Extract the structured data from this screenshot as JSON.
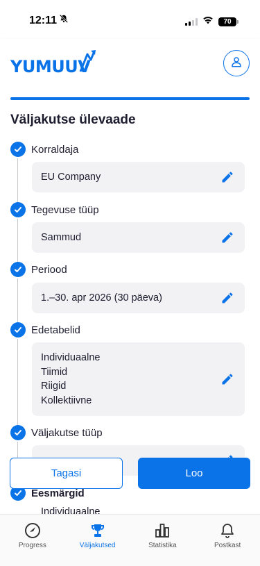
{
  "status_bar": {
    "time": "12:11",
    "battery": "70"
  },
  "header": {
    "logo_text": "YUMUUV"
  },
  "section": {
    "title": "Väljakutse ülevaade"
  },
  "steps": [
    {
      "label": "Korraldaja",
      "lines": [
        "EU Company"
      ]
    },
    {
      "label": "Tegevuse tüüp",
      "lines": [
        "Sammud"
      ]
    },
    {
      "label": "Periood",
      "lines": [
        "1.–30. apr 2026 (30 päeva)"
      ]
    },
    {
      "label": "Edetabelid",
      "lines": [
        "Individuaalne",
        "Tiimid",
        "Riigid",
        "Kollektiivne"
      ]
    },
    {
      "label": "Väljakutse tüüp",
      "lines": []
    },
    {
      "label": "Eesmärgid",
      "lines": [
        "Individuaalne"
      ]
    }
  ],
  "buttons": {
    "back": "Tagasi",
    "create": "Loo"
  },
  "tabs": [
    {
      "label": "Progress",
      "icon": "progress-gauge-icon",
      "active": false
    },
    {
      "label": "Väljakutsed",
      "icon": "trophy-icon",
      "active": true
    },
    {
      "label": "Statistika",
      "icon": "bar-chart-icon",
      "active": false
    },
    {
      "label": "Postkast",
      "icon": "bell-icon",
      "active": false
    }
  ],
  "colors": {
    "accent": "#0a73e8",
    "card_bg": "#f2f2f5",
    "text": "#1c1c2e"
  }
}
